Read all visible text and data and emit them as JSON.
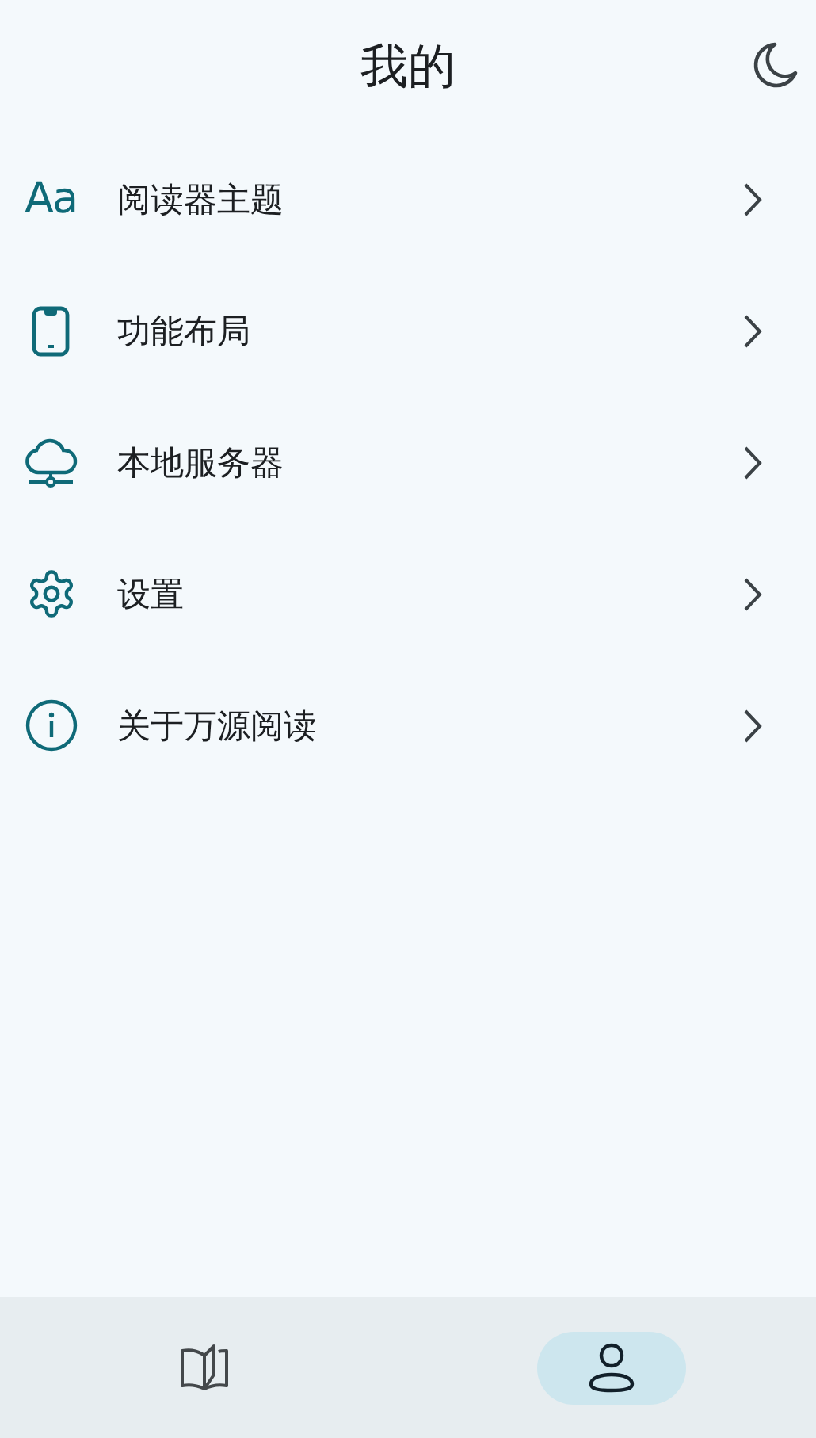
{
  "header": {
    "title": "我的"
  },
  "menu": [
    {
      "kind": "font",
      "icon_text": "Aa",
      "label": "阅读器主题"
    },
    {
      "kind": "phone",
      "label": "功能布局"
    },
    {
      "kind": "cloud",
      "label": "本地服务器"
    },
    {
      "kind": "gear",
      "label": "设置"
    },
    {
      "kind": "info",
      "label": "关于万源阅读"
    }
  ],
  "nav": [
    {
      "kind": "book",
      "selected": false
    },
    {
      "kind": "person",
      "selected": true
    }
  ]
}
